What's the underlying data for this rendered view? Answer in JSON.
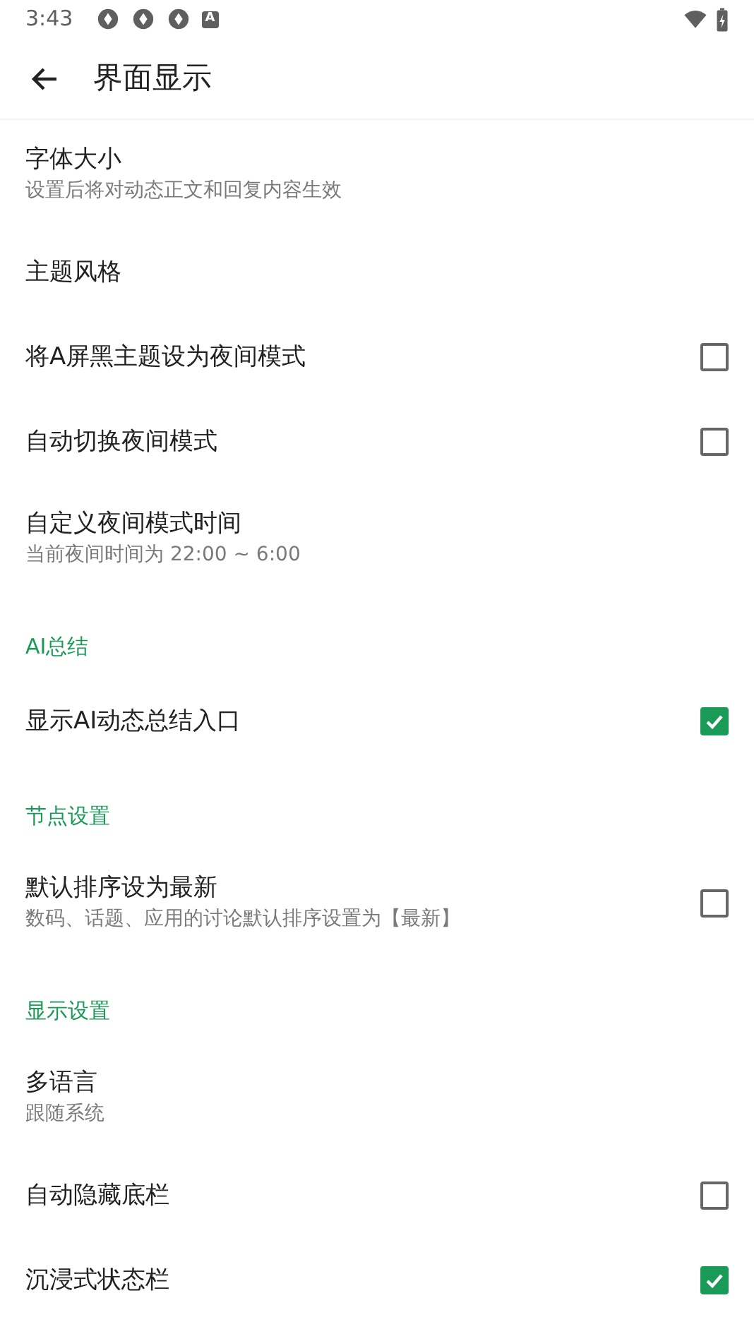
{
  "status_bar": {
    "time": "3:43",
    "badge": "A"
  },
  "toolbar": {
    "title": "界面显示"
  },
  "rows": [
    {
      "kind": "setting",
      "title": "字体大小",
      "summary": "设置后将对动态正文和回复内容生效"
    },
    {
      "kind": "setting",
      "title": "主题风格"
    },
    {
      "kind": "check",
      "title": "将A屏黑主题设为夜间模式",
      "checked": false
    },
    {
      "kind": "check",
      "title": "自动切换夜间模式",
      "checked": false
    },
    {
      "kind": "setting",
      "title": "自定义夜间模式时间",
      "summary": "当前夜间时间为 22:00 ~ 6:00"
    },
    {
      "kind": "header",
      "title": "AI总结"
    },
    {
      "kind": "check",
      "title": "显示AI动态总结入口",
      "checked": true
    },
    {
      "kind": "header",
      "title": "节点设置"
    },
    {
      "kind": "check",
      "title": "默认排序设为最新",
      "summary": "数码、话题、应用的讨论默认排序设置为【最新】",
      "checked": false
    },
    {
      "kind": "header",
      "title": "显示设置"
    },
    {
      "kind": "setting",
      "title": "多语言",
      "summary": "跟随系统"
    },
    {
      "kind": "check",
      "title": "自动隐藏底栏",
      "checked": false
    },
    {
      "kind": "check",
      "title": "沉浸式状态栏",
      "checked": true
    }
  ]
}
